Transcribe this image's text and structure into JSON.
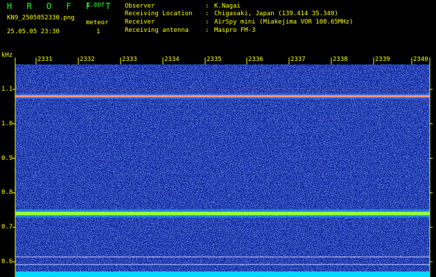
{
  "brand": "H R O F F T",
  "version": "1.00f",
  "filename": "KN9_2505052330.png",
  "datetime": "25.05.05 23:30",
  "meteor_label": "meteor",
  "meteor_count": "1",
  "info": [
    {
      "key": "Observer",
      "value": "K.Nagai"
    },
    {
      "key": "Receiving Location",
      "value": "Chigasaki, Japan (139.414 35.340)"
    },
    {
      "key": "Receiver",
      "value": "AirSpy mini (Miakejima VOR 108.65MHz)"
    },
    {
      "key": "Receiving antenna",
      "value": "Maspro FM-3"
    }
  ],
  "colon": ":",
  "unit": "kHz",
  "y_ticks": [
    "1.1",
    "1.0",
    "0.9",
    "0.8",
    "0.7",
    "0.6"
  ],
  "x_ticks": [
    "2331",
    "2332",
    "2333",
    "2334",
    "2335",
    "2336",
    "2337",
    "2338",
    "2339",
    "2340"
  ],
  "colors": {
    "background": "#000000",
    "plot_bg": "#0a1c9a",
    "text": "#ffff00",
    "brand": "#19ff19"
  },
  "signal_lines_khz": [
    1.08,
    0.74
  ]
}
